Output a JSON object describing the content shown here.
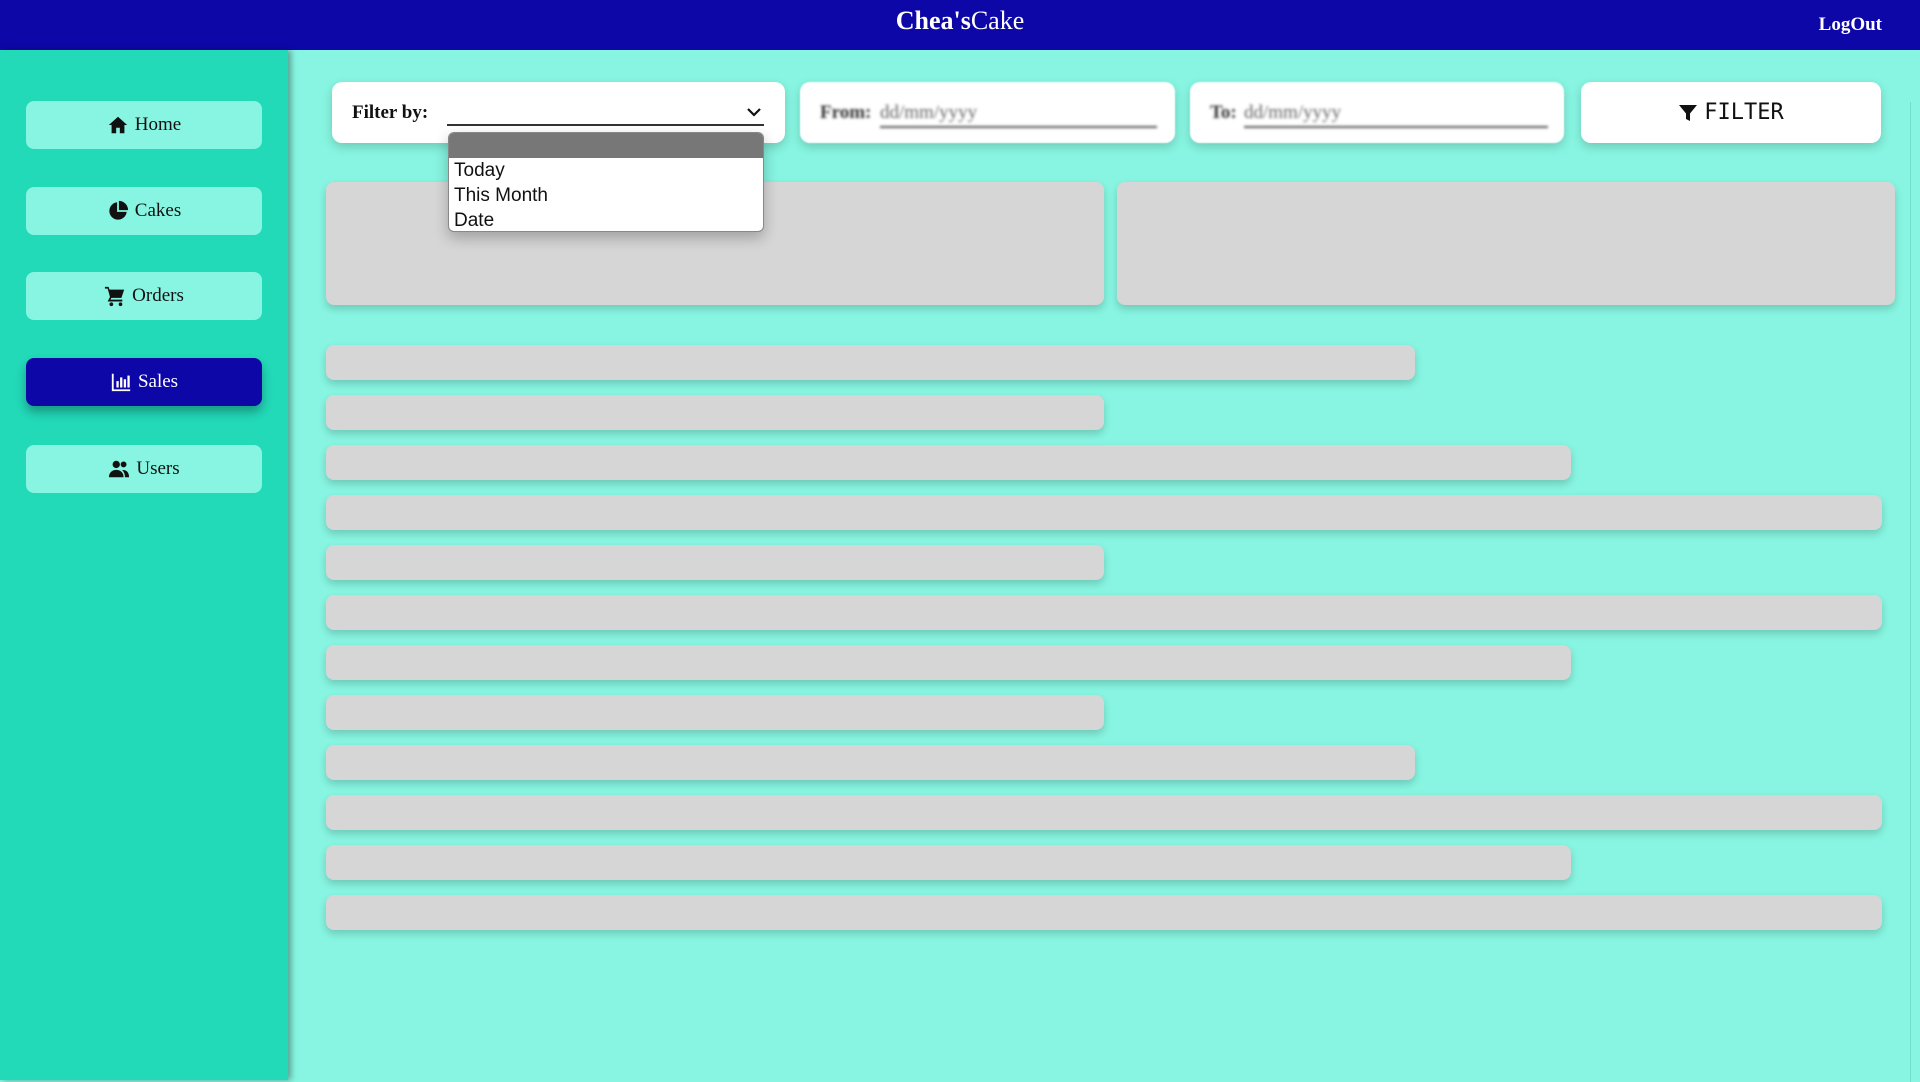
{
  "header": {
    "brand_bold": "Chea's",
    "brand_regular": "Cake",
    "logout_label": "LogOut"
  },
  "sidebar": {
    "items": [
      {
        "label": "Home",
        "icon": "home-icon"
      },
      {
        "label": "Cakes",
        "icon": "pie-chart-icon"
      },
      {
        "label": "Orders",
        "icon": "cart-icon"
      },
      {
        "label": "Sales",
        "icon": "bar-chart-icon",
        "active": true
      },
      {
        "label": "Users",
        "icon": "users-icon"
      }
    ]
  },
  "filters": {
    "filter_by_label": "Filter by:",
    "selected_value": "",
    "options": [
      "",
      "Today",
      "This Month",
      "Date"
    ],
    "from_label": "From:",
    "from_placeholder": "dd/mm/yyyy",
    "to_label": "To:",
    "to_placeholder": "dd/mm/yyyy",
    "filter_button_label": "FILTER"
  },
  "colors": {
    "header_bg": "#0e07a8",
    "sidebar_bg": "#22d9b8",
    "page_bg": "#87f5e1",
    "skeleton": "#d6d6d6"
  }
}
